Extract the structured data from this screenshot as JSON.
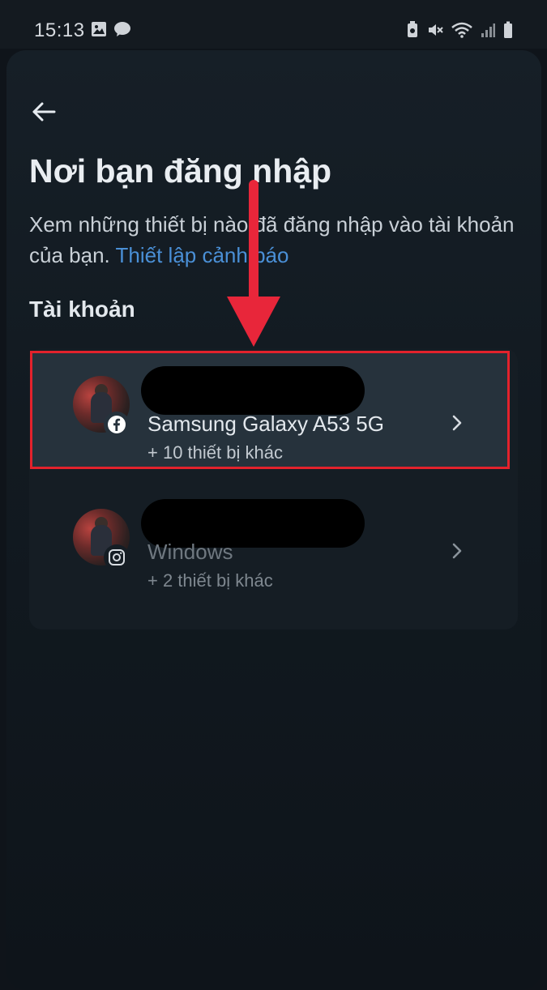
{
  "status_bar": {
    "time": "15:13"
  },
  "header": {
    "back_icon": "arrow-left-icon",
    "title": "Nơi bạn đăng nhập",
    "description": "Xem những thiết bị nào đã đăng nhập vào tài khoản của bạn.",
    "alert_link": "Thiết lập cảnh báo"
  },
  "section": {
    "title": "Tài khoản"
  },
  "accounts": [
    {
      "platform_icon": "facebook-icon",
      "device": "Samsung Galaxy A53 5G",
      "more_devices": "+ 10 thiết bị khác"
    },
    {
      "platform_icon": "instagram-icon",
      "device": "Windows",
      "more_devices": "+ 2 thiết bị khác"
    }
  ],
  "colors": {
    "link": "#4a8fd6",
    "highlight_border": "#e3222c",
    "annotation_arrow": "#e8263a"
  }
}
